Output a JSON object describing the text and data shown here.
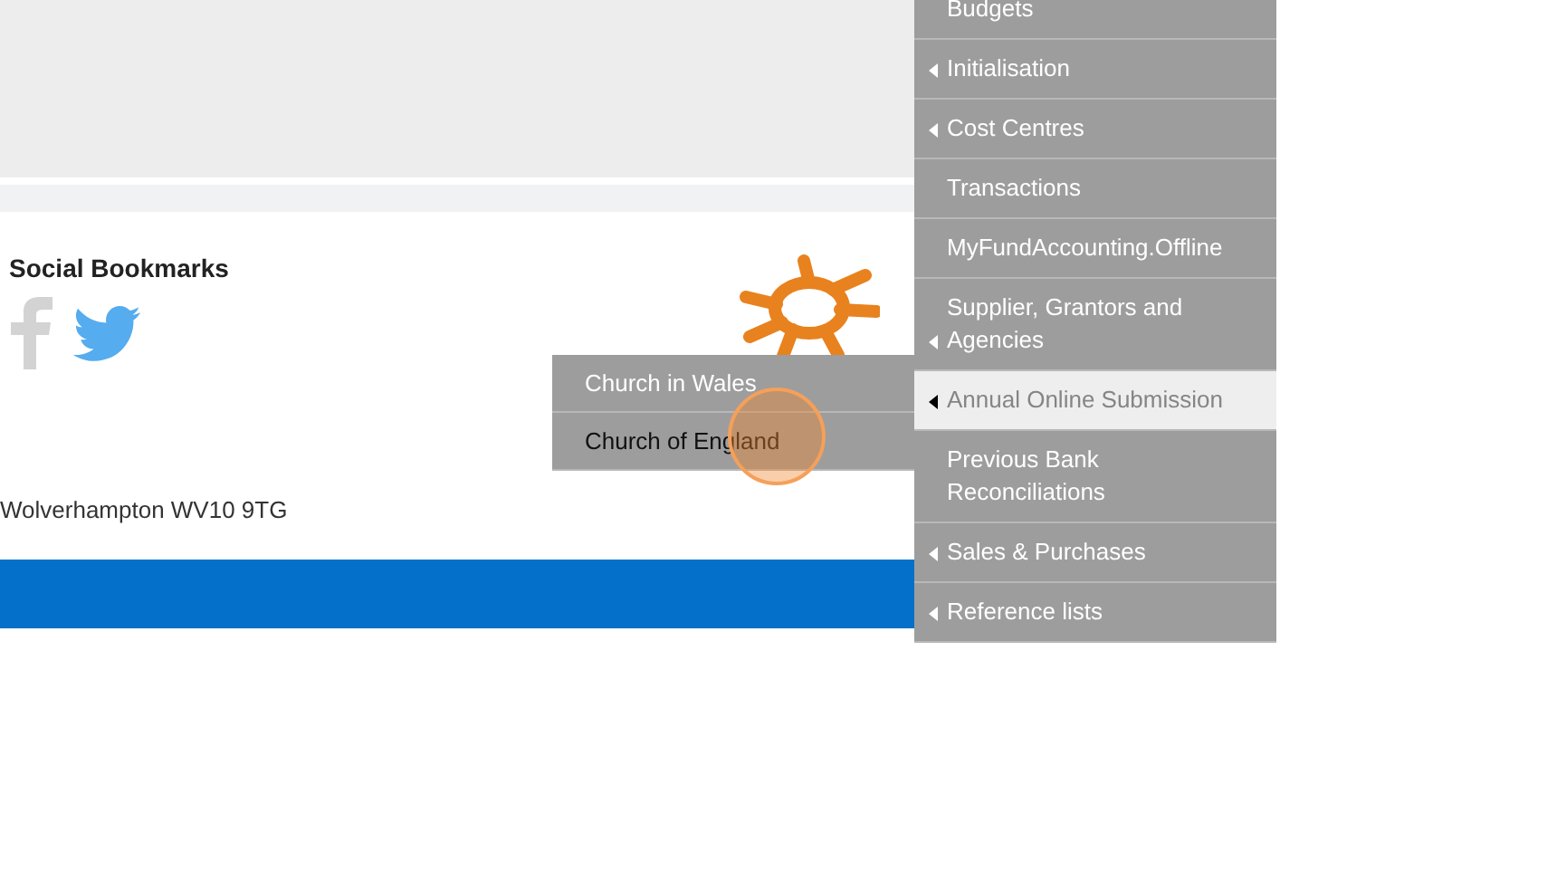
{
  "footer": {
    "social_heading": "Social Bookmarks",
    "address": "Wolverhampton WV10 9TG"
  },
  "menu": {
    "items": [
      {
        "label": "Budgets",
        "has_submenu": false,
        "selected": false
      },
      {
        "label": "Initialisation",
        "has_submenu": true,
        "selected": false
      },
      {
        "label": "Cost Centres",
        "has_submenu": true,
        "selected": false
      },
      {
        "label": "Transactions",
        "has_submenu": false,
        "selected": false
      },
      {
        "label": "MyFundAccounting.Offline",
        "has_submenu": false,
        "selected": false
      },
      {
        "label": "Supplier, Grantors and Agencies",
        "has_submenu": true,
        "selected": false
      },
      {
        "label": "Annual Online Submission",
        "has_submenu": true,
        "selected": true
      },
      {
        "label": "Previous Bank Reconciliations",
        "has_submenu": false,
        "selected": false
      },
      {
        "label": "Sales & Purchases",
        "has_submenu": true,
        "selected": false
      },
      {
        "label": "Reference lists",
        "has_submenu": true,
        "selected": false
      }
    ]
  },
  "submenu": {
    "items": [
      {
        "label": "Church in Wales",
        "selected": false
      },
      {
        "label": "Church of England",
        "selected": true
      }
    ]
  }
}
